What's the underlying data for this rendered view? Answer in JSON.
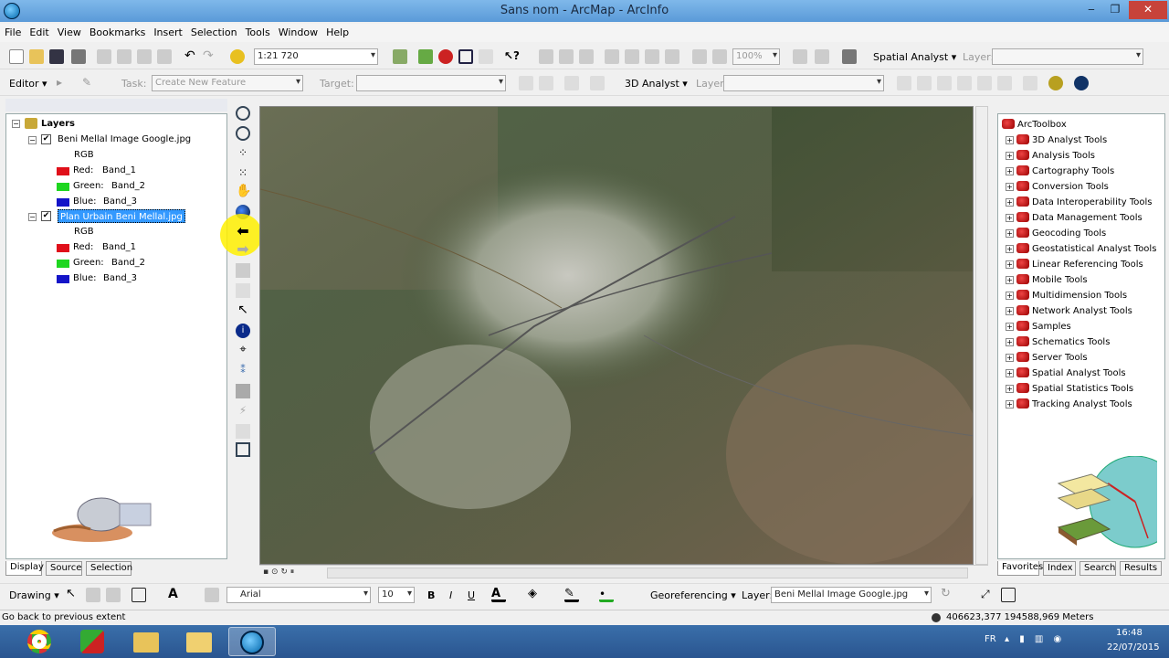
{
  "window": {
    "title": "Sans nom - ArcMap - ArcInfo",
    "min": "‒",
    "max": "❐",
    "close": "✕"
  },
  "menu": [
    "File",
    "Edit",
    "View",
    "Bookmarks",
    "Insert",
    "Selection",
    "Tools",
    "Window",
    "Help"
  ],
  "toolbar1": {
    "scale": "1:21 720",
    "zoom": "100%",
    "spatial_analyst": "Spatial Analyst ▾",
    "layer_label": "Layer:"
  },
  "toolbar2": {
    "editor": "Editor ▾",
    "task_label": "Task:",
    "task_value": "Create New Feature",
    "target_label": "Target:",
    "analyst_3d": "3D Analyst ▾",
    "layer_label": "Layer:"
  },
  "toc": {
    "root": "Layers",
    "layers": [
      {
        "name": "Beni Mellal Image Google.jpg",
        "selected": false,
        "rgb": "RGB",
        "bands": [
          {
            "label": "Red:",
            "band": "Band_1",
            "color": "#e0101a"
          },
          {
            "label": "Green:",
            "band": "Band_2",
            "color": "#1ed620"
          },
          {
            "label": "Blue:",
            "band": "Band_3",
            "color": "#1414c8"
          }
        ]
      },
      {
        "name": "Plan Urbain Beni Mellal.jpg",
        "selected": true,
        "rgb": "RGB",
        "bands": [
          {
            "label": "Red:",
            "band": "Band_1",
            "color": "#e0101a"
          },
          {
            "label": "Green:",
            "band": "Band_2",
            "color": "#1ed620"
          },
          {
            "label": "Blue:",
            "band": "Band_3",
            "color": "#1414c8"
          }
        ]
      }
    ],
    "tabs": [
      "Display",
      "Source",
      "Selection"
    ]
  },
  "toolbox": {
    "root": "ArcToolbox",
    "items": [
      "3D Analyst Tools",
      "Analysis Tools",
      "Cartography Tools",
      "Conversion Tools",
      "Data Interoperability Tools",
      "Data Management Tools",
      "Geocoding Tools",
      "Geostatistical Analyst Tools",
      "Linear Referencing Tools",
      "Mobile Tools",
      "Multidimension Tools",
      "Network Analyst Tools",
      "Samples",
      "Schematics Tools",
      "Server Tools",
      "Spatial Analyst Tools",
      "Spatial Statistics Tools",
      "Tracking Analyst Tools"
    ],
    "tabs": [
      "Favorites",
      "Index",
      "Search",
      "Results"
    ]
  },
  "drawbar": {
    "drawing": "Drawing ▾",
    "font": "Arial",
    "size": "10",
    "bold": "B",
    "italic": "I",
    "underline": "U",
    "georef": "Georeferencing ▾",
    "layer_label": "Layer:",
    "layer_value": "Beni Mellal Image Google.jpg"
  },
  "status": {
    "message": "Go back to previous extent",
    "coords": "406623,377  194588,969 Meters"
  },
  "taskbar": {
    "lang": "FR",
    "time": "16:48",
    "date": "22/07/2015"
  }
}
